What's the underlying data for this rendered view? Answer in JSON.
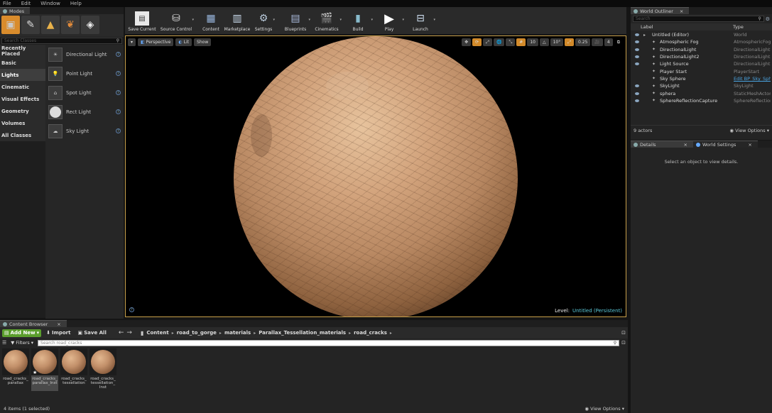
{
  "menu": [
    "File",
    "Edit",
    "Window",
    "Help"
  ],
  "modes": {
    "tab_label": "Modes",
    "search_placeholder": "Search Classes",
    "categories": [
      "Recently Placed",
      "Basic",
      "Lights",
      "Cinematic",
      "Visual Effects",
      "Geometry",
      "Volumes",
      "All Classes"
    ],
    "selected_category": "Lights",
    "items": [
      {
        "label": "Directional Light",
        "icon": "directional-light-icon"
      },
      {
        "label": "Point Light",
        "icon": "point-light-icon"
      },
      {
        "label": "Spot Light",
        "icon": "spot-light-icon"
      },
      {
        "label": "Rect Light",
        "icon": "rect-light-icon"
      },
      {
        "label": "Sky Light",
        "icon": "sky-light-icon"
      }
    ]
  },
  "toolbar": {
    "buttons": [
      {
        "label": "Save Current",
        "icon": "save-icon"
      },
      {
        "label": "Source Control",
        "icon": "source-control-icon"
      },
      {
        "label": "Content",
        "icon": "content-icon"
      },
      {
        "label": "Marketplace",
        "icon": "marketplace-icon"
      },
      {
        "label": "Settings",
        "icon": "settings-icon"
      },
      {
        "label": "Blueprints",
        "icon": "blueprints-icon"
      },
      {
        "label": "Cinematics",
        "icon": "cinematics-icon"
      },
      {
        "label": "Build",
        "icon": "build-icon"
      },
      {
        "label": "Play",
        "icon": "play-icon"
      },
      {
        "label": "Launch",
        "icon": "launch-icon"
      }
    ]
  },
  "viewport": {
    "perspective_label": "Perspective",
    "lit_label": "Lit",
    "show_label": "Show",
    "grid_snap": "10",
    "rot_snap": "10°",
    "scale_snap": "0.25",
    "camera_speed": "4",
    "level_prefix": "Level:",
    "level_name": "Untitled (Persistent)",
    "colors": {
      "border": "#c8a04a",
      "sphere_light": "#e2b78f",
      "sphere_dark": "#3a2517"
    }
  },
  "outliner": {
    "tab_label": "World Outliner",
    "search_placeholder": "Search",
    "col_label": "Label",
    "col_type": "Type",
    "rows": [
      {
        "label": "Untitled (Editor)",
        "type": "World",
        "eye": true,
        "indent": 0,
        "link": false
      },
      {
        "label": "Atmospheric Fog",
        "type": "AtmosphericFog",
        "eye": true,
        "indent": 1,
        "link": false
      },
      {
        "label": "DirectionalLight",
        "type": "DirectionalLight",
        "eye": true,
        "indent": 1,
        "link": false
      },
      {
        "label": "DirectionalLight2",
        "type": "DirectionalLight",
        "eye": true,
        "indent": 1,
        "link": false
      },
      {
        "label": "Light Source",
        "type": "DirectionalLight",
        "eye": true,
        "indent": 1,
        "link": false
      },
      {
        "label": "Player Start",
        "type": "PlayerStart",
        "eye": false,
        "indent": 1,
        "link": false
      },
      {
        "label": "Sky Sphere",
        "type": "Edit BP_Sky_Sph",
        "eye": false,
        "indent": 1,
        "link": true
      },
      {
        "label": "SkyLight",
        "type": "SkyLight",
        "eye": true,
        "indent": 1,
        "link": false
      },
      {
        "label": "sphera",
        "type": "StaticMeshActor",
        "eye": true,
        "indent": 1,
        "link": false
      },
      {
        "label": "SphereReflectionCapture",
        "type": "SphereReflection",
        "eye": true,
        "indent": 1,
        "link": false
      }
    ],
    "actor_count": "9 actors",
    "view_options": "View Options"
  },
  "details": {
    "tab_label": "Details",
    "world_settings_label": "World Settings",
    "empty_text": "Select an object to view details."
  },
  "content_browser": {
    "tab_label": "Content Browser",
    "add_new": "Add New",
    "import": "Import",
    "save_all": "Save All",
    "breadcrumbs": [
      "Content",
      "road_to_gorge",
      "materials",
      "Parallax_Tessellation_materials",
      "road_cracks"
    ],
    "filters": "Filters",
    "search_placeholder": "Search road_cracks",
    "assets": [
      {
        "label": "road_cracks_\nparallax"
      },
      {
        "label": "road_cracks_\nparallax_Inst"
      },
      {
        "label": "road_cracks_\ntessellation"
      },
      {
        "label": "road_cracks_\ntessellation_\nInst"
      }
    ],
    "status": "4 items (1 selected)",
    "view_options": "View Options"
  }
}
